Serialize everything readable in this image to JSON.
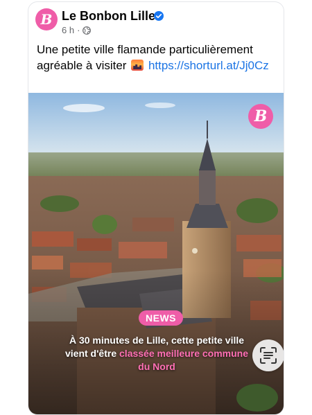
{
  "post": {
    "avatar_letter": "B",
    "page_name": "Le Bonbon Lille",
    "time": "6 h",
    "separator": "·",
    "text_before": "Une petite ville flamande particulièrement agréable à visiter",
    "emoji": "city-sunset",
    "link": "https://shorturl.at/Jj0Cz"
  },
  "image": {
    "logo_letter": "B",
    "tag": "NEWS",
    "caption_line1": "À 30 minutes de Lille, cette petite ville",
    "caption_line2_before": "vient d'être ",
    "caption_highlight": "classée meilleure commune",
    "caption_line3": "du Nord"
  },
  "colors": {
    "brand_pink": "#ef5da8",
    "link_blue": "#1b74e4",
    "verified_blue": "#1877f2",
    "meta_gray": "#65676b"
  },
  "icons": [
    "verified-badge-icon",
    "globe-icon",
    "visual-search-icon"
  ]
}
